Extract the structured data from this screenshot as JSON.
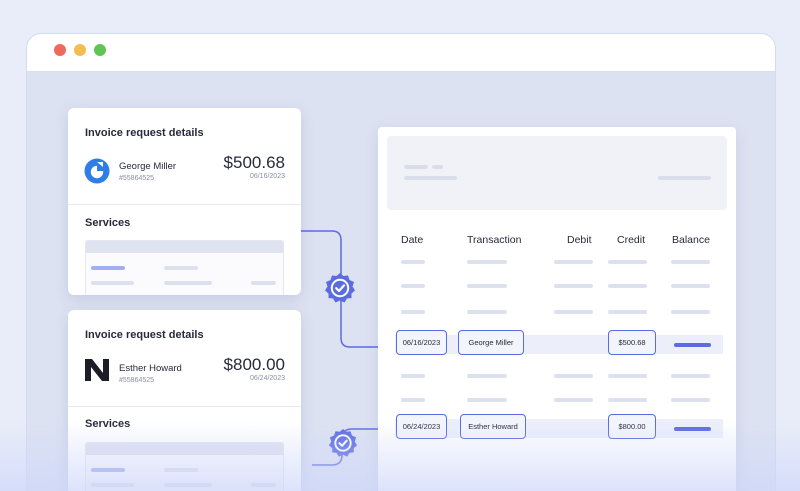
{
  "colors": {
    "accent": "#5b6be0",
    "window_bg": "#dde2f2",
    "page_bg": "#e9edf9"
  },
  "window": {
    "controls": [
      "close-icon",
      "minimize-icon",
      "maximize-icon"
    ]
  },
  "invoices": [
    {
      "title": "Invoice request details",
      "customer": "George Miller",
      "customer_id": "#55864525",
      "amount": "$500.68",
      "date": "06/16/2023",
      "services_title": "Services",
      "logo": "george-miller-logo-icon"
    },
    {
      "title": "Invoice request details",
      "customer": "Esther Howard",
      "customer_id": "#55864525",
      "amount": "$800.00",
      "date": "06/24/2023",
      "services_title": "Services",
      "logo": "esther-howard-logo-icon"
    }
  ],
  "ledger": {
    "columns": [
      "Date",
      "Transaction",
      "Debit",
      "Credit",
      "Balance"
    ],
    "matched_rows": [
      {
        "date": "06/16/2023",
        "transaction": "George Miller",
        "credit": "$500.68"
      },
      {
        "date": "06/24/2023",
        "transaction": "Esther Howard",
        "credit": "$800.00"
      }
    ]
  },
  "match_icons": [
    "verified-check-icon",
    "verified-check-icon"
  ]
}
